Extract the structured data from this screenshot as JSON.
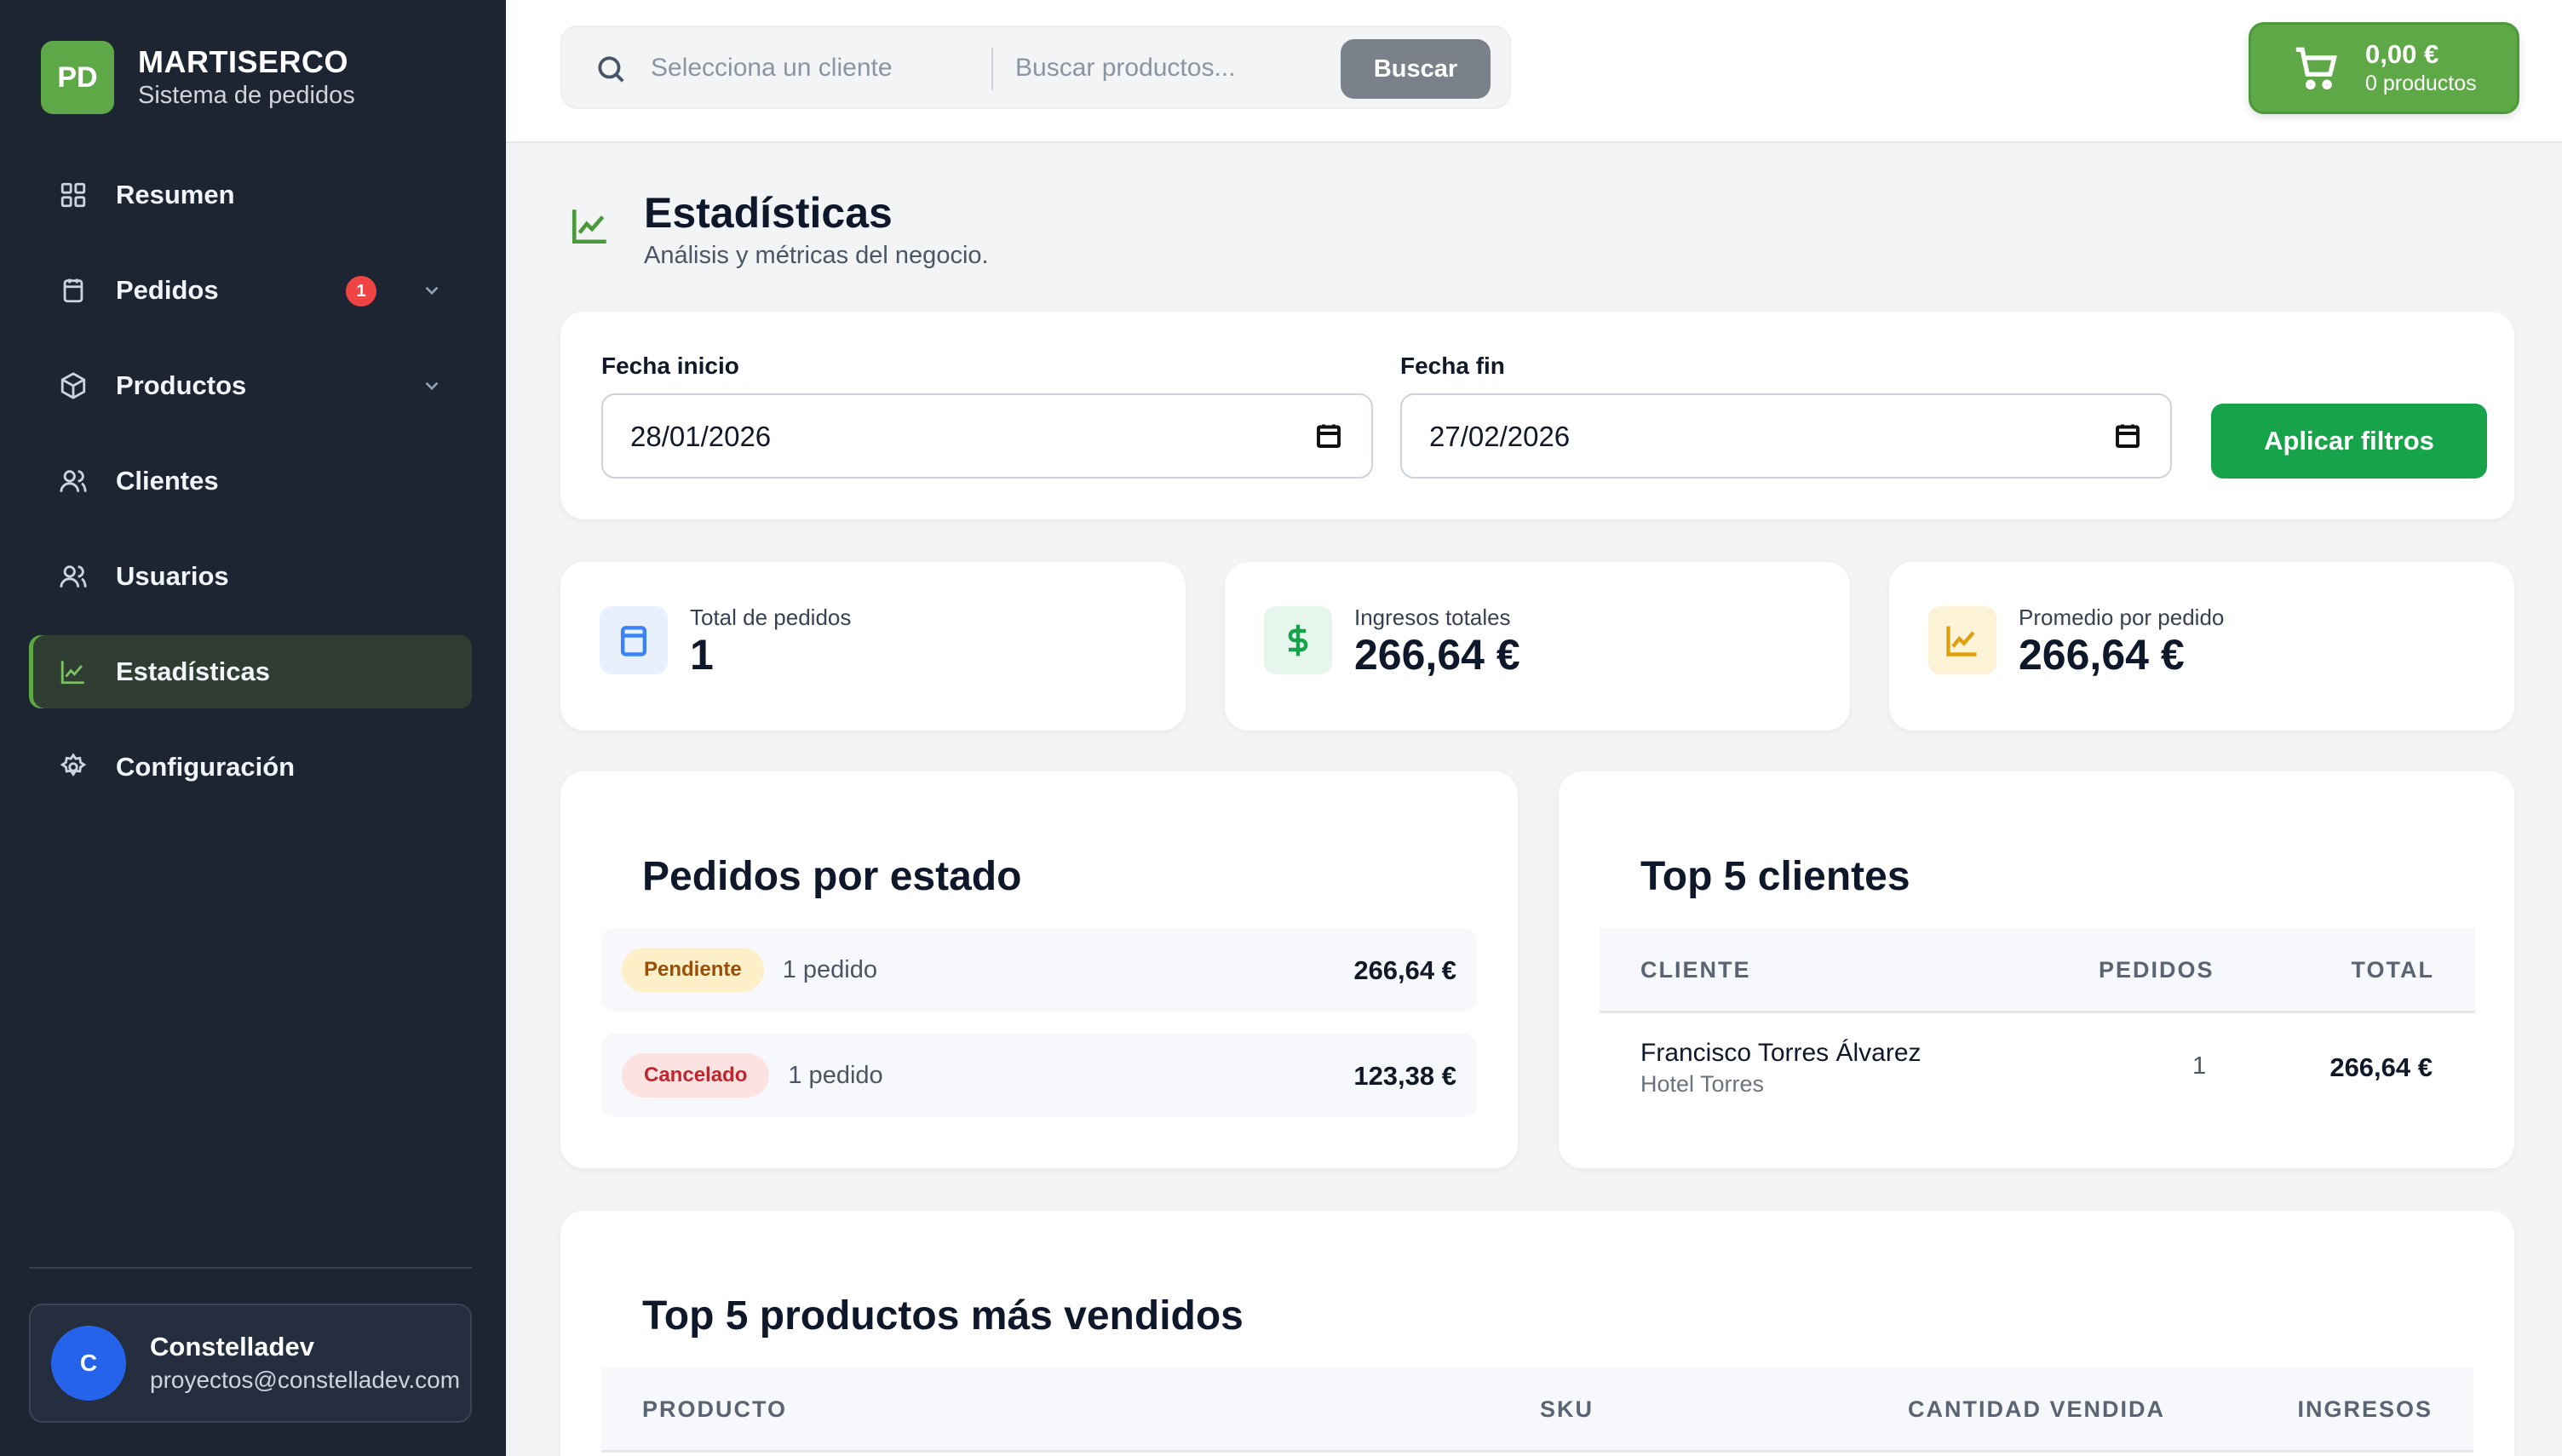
{
  "brand": {
    "logo": "PD",
    "name": "MARTISERCO",
    "subtitle": "Sistema de pedidos",
    "logo_color": "#5fa847"
  },
  "sidebar": {
    "items": [
      {
        "label": "Resumen",
        "icon": "grid-icon"
      },
      {
        "label": "Pedidos",
        "icon": "clipboard-icon",
        "badge": "1",
        "expandable": true
      },
      {
        "label": "Productos",
        "icon": "box-icon",
        "expandable": true
      },
      {
        "label": "Clientes",
        "icon": "users-icon"
      },
      {
        "label": "Usuarios",
        "icon": "users-icon"
      },
      {
        "label": "Estadísticas",
        "icon": "chart-icon",
        "active": true
      },
      {
        "label": "Configuración",
        "icon": "gear-icon"
      }
    ]
  },
  "user": {
    "initial": "C",
    "name": "Constelladev",
    "email": "proyectos@constelladev.com"
  },
  "search": {
    "client_placeholder": "Selecciona un cliente",
    "product_placeholder": "Buscar productos...",
    "button": "Buscar"
  },
  "cart": {
    "total": "0,00 €",
    "count": "0 productos",
    "color": "#5fa847"
  },
  "page": {
    "title": "Estadísticas",
    "subtitle": "Análisis y métricas del negocio."
  },
  "filters": {
    "start_label": "Fecha inicio",
    "start_value": "28/01/2026",
    "end_label": "Fecha fin",
    "end_value": "27/02/2026",
    "apply": "Aplicar filtros",
    "apply_color": "#16a34a"
  },
  "stats": [
    {
      "label": "Total de pedidos",
      "value": "1",
      "icon": "clipboard-icon"
    },
    {
      "label": "Ingresos totales",
      "value": "266,64 €",
      "icon": "dollar-icon"
    },
    {
      "label": "Promedio por pedido",
      "value": "266,64 €",
      "icon": "chart-icon"
    }
  ],
  "status_card": {
    "title": "Pedidos por estado",
    "rows": [
      {
        "status": "Pendiente",
        "count": "1 pedido",
        "total": "266,64 €"
      },
      {
        "status": "Cancelado",
        "count": "1 pedido",
        "total": "123,38 €"
      }
    ]
  },
  "top_clients": {
    "title": "Top 5 clientes",
    "columns": [
      "CLIENTE",
      "PEDIDOS",
      "TOTAL"
    ],
    "rows": [
      {
        "name": "Francisco Torres Álvarez",
        "company": "Hotel Torres",
        "orders": "1",
        "total": "266,64 €"
      }
    ]
  },
  "top_products": {
    "title": "Top 5 productos más vendidos",
    "columns": [
      "PRODUCTO",
      "SKU",
      "CANTIDAD VENDIDA",
      "INGRESOS"
    ]
  }
}
